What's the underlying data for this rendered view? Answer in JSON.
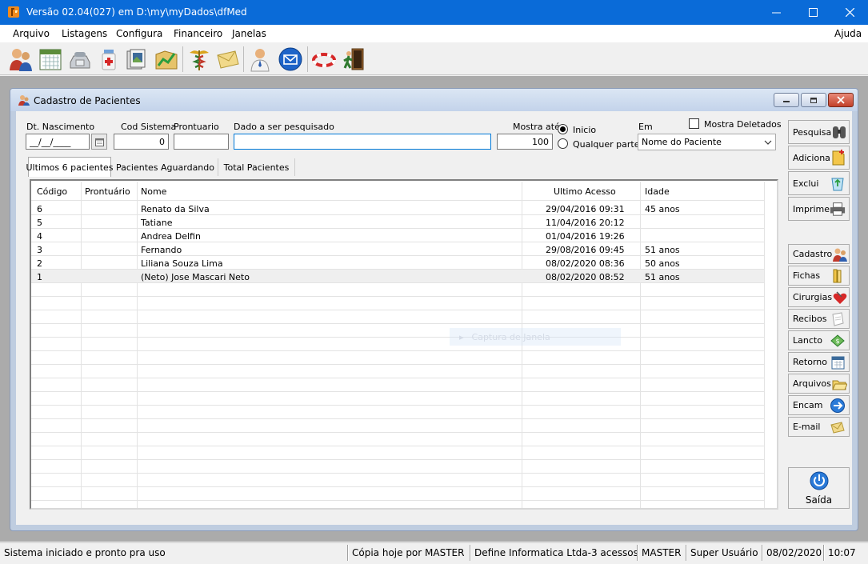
{
  "window": {
    "title": "Versão 02.04(027) em D:\\my\\myDados\\dfMed"
  },
  "menu": {
    "items": [
      "Arquivo",
      "Listagens",
      "Configura",
      "Financeiro",
      "Janelas"
    ],
    "help": "Ajuda"
  },
  "toolbar": {
    "icons": [
      "patients-icon",
      "calendar-icon",
      "phone-icon",
      "medicine-icon",
      "documents-icon",
      "finance-chart-icon",
      "caduceus-icon",
      "envelope-icon",
      "doctor-icon",
      "email-icon",
      "lifebuoy-icon",
      "exit-door-icon"
    ]
  },
  "child_window": {
    "title": "Cadastro de Pacientes"
  },
  "form": {
    "dt_nascimento_label": "Dt. Nascimento",
    "dt_nascimento_value": "__/__/____",
    "cod_sistema_label": "Cod Sistema",
    "cod_sistema_value": "0",
    "prontuario_label": "Prontuario",
    "prontuario_value": "",
    "pesquisa_label": "Dado a ser pesquisado",
    "pesquisa_value": "",
    "mostra_ate_label": "Mostra até",
    "mostra_ate_value": "100",
    "radio_inicio": "Inicio",
    "radio_qualquer": "Qualquer parte",
    "em_label": "Em",
    "em_value": "Nome do Paciente",
    "mostra_deletados": "Mostra Deletados"
  },
  "tabs": [
    "Ultimos 6 pacientes",
    "Pacientes Aguardando",
    "Total Pacientes"
  ],
  "grid": {
    "columns": [
      "Código",
      "Prontuário",
      "Nome",
      "Ultimo Acesso",
      "Idade"
    ],
    "rows": [
      [
        "6",
        "",
        "Renato da Silva",
        "29/04/2016 09:31",
        "45 anos"
      ],
      [
        "5",
        "",
        "Tatiane",
        "11/04/2016 20:12",
        ""
      ],
      [
        "4",
        "",
        "Andrea Delfin",
        "01/04/2016 19:26",
        ""
      ],
      [
        "3",
        "",
        "Fernando",
        "29/08/2016 09:45",
        "51 anos"
      ],
      [
        "2",
        "",
        "Liliana Souza Lima",
        "08/02/2020 08:36",
        "50 anos"
      ],
      [
        "1",
        "",
        "(Neto) Jose Mascari Neto",
        "08/02/2020 08:52",
        "51 anos"
      ]
    ],
    "ghost_text": "Captura de Janela"
  },
  "side_buttons": {
    "pesquisa": "Pesquisa",
    "adiciona": "Adiciona",
    "exclui": "Exclui",
    "imprime": "Imprime",
    "cadastro": "Cadastro",
    "fichas": "Fichas",
    "cirurgias": "Cirurgias",
    "recibos": "Recibos",
    "lancto": "Lancto",
    "retorno": "Retorno",
    "arquivos": "Arquivos",
    "encam": "Encam",
    "email": "E-mail",
    "saida": "Saída"
  },
  "status": {
    "message": "Sistema iniciado e pronto pra uso",
    "copia": "Cópia hoje por MASTER",
    "license": "Define Informatica Ltda-3 acessos",
    "user": "MASTER",
    "role": "Super Usuário",
    "date": "08/02/2020",
    "time": "10:07"
  }
}
